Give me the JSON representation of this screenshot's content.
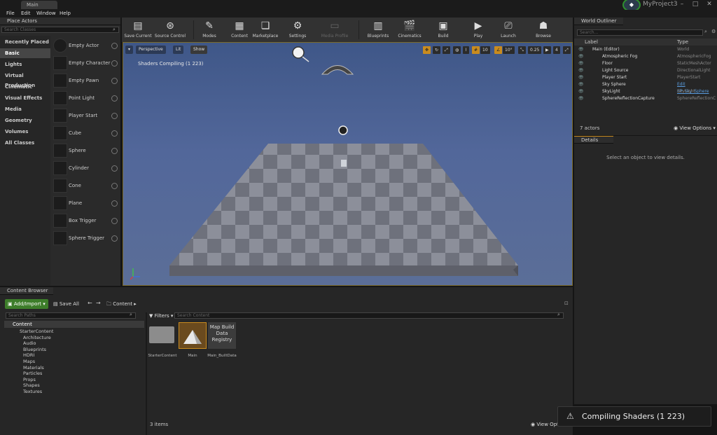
{
  "titlebar": {
    "tab": "Main",
    "project": "MyProject3",
    "min": "–",
    "max": "□",
    "close": "✕"
  },
  "menu": [
    "File",
    "Edit",
    "Window",
    "Help"
  ],
  "place_actors": {
    "title": "Place Actors",
    "search_placeholder": "Search Classes",
    "categories": [
      "Recently Placed",
      "Basic",
      "Lights",
      "Virtual Production",
      "Cinematic",
      "Visual Effects",
      "Media",
      "Geometry",
      "Volumes",
      "All Classes"
    ],
    "actors": [
      "Empty Actor",
      "Empty Character",
      "Empty Pawn",
      "Point Light",
      "Player Start",
      "Cube",
      "Sphere",
      "Cylinder",
      "Cone",
      "Plane",
      "Box Trigger",
      "Sphere Trigger"
    ]
  },
  "toolbar": [
    "Save Current",
    "Source Control",
    "Modes",
    "Content",
    "Marketplace",
    "Settings",
    "Media Profile",
    "Blueprints",
    "Cinematics",
    "Build",
    "Play",
    "Launch",
    "Browse"
  ],
  "viewport": {
    "perspective": "Perspective",
    "lit": "Lit",
    "show": "Show",
    "status": "Shaders Compiling (1 223)",
    "grid": "10",
    "angle": "10°",
    "scale": "0.25",
    "cam": "4"
  },
  "outliner": {
    "title": "World Outliner",
    "search_placeholder": "Search...",
    "col_label": "Label",
    "col_type": "Type",
    "rows": [
      {
        "label": "Main (Editor)",
        "type": "World"
      },
      {
        "label": "Atmospheric Fog",
        "type": "AtmosphericFog"
      },
      {
        "label": "Floor",
        "type": "StaticMeshActor"
      },
      {
        "label": "Light Source",
        "type": "DirectionalLight"
      },
      {
        "label": "Player Start",
        "type": "PlayerStart"
      },
      {
        "label": "Sky Sphere",
        "type": "Edit BP_Sky_Sphere"
      },
      {
        "label": "SkyLight",
        "type": "SkyLight"
      },
      {
        "label": "SphereReflectionCapture",
        "type": "SphereReflectionC"
      }
    ],
    "count": "7 actors",
    "view_options": "View Options"
  },
  "details": {
    "title": "Details",
    "empty": "Select an object to view details."
  },
  "content_browser": {
    "title": "Content Browser",
    "add_import": "Add/Import",
    "save_all": "Save All",
    "path": "Content",
    "search_paths": "Search Paths",
    "filters": "Filters",
    "search_content": "Search Content",
    "tree_root": "Content",
    "tree": [
      "StarterContent",
      "Architecture",
      "Audio",
      "Blueprints",
      "HDRI",
      "Maps",
      "Materials",
      "Particles",
      "Props",
      "Shapes",
      "Textures"
    ],
    "assets": [
      "StarterContent",
      "Main",
      "Main_BuiltData"
    ],
    "registry": "Map Build Data Registry",
    "items": "3 items",
    "view_options": "View Options"
  },
  "toast": {
    "text": "Compiling Shaders (1 223)"
  },
  "colors": {
    "accent": "#e8a020",
    "add_green": "#3d7d2a",
    "viewport_sky": "#4b6198"
  }
}
